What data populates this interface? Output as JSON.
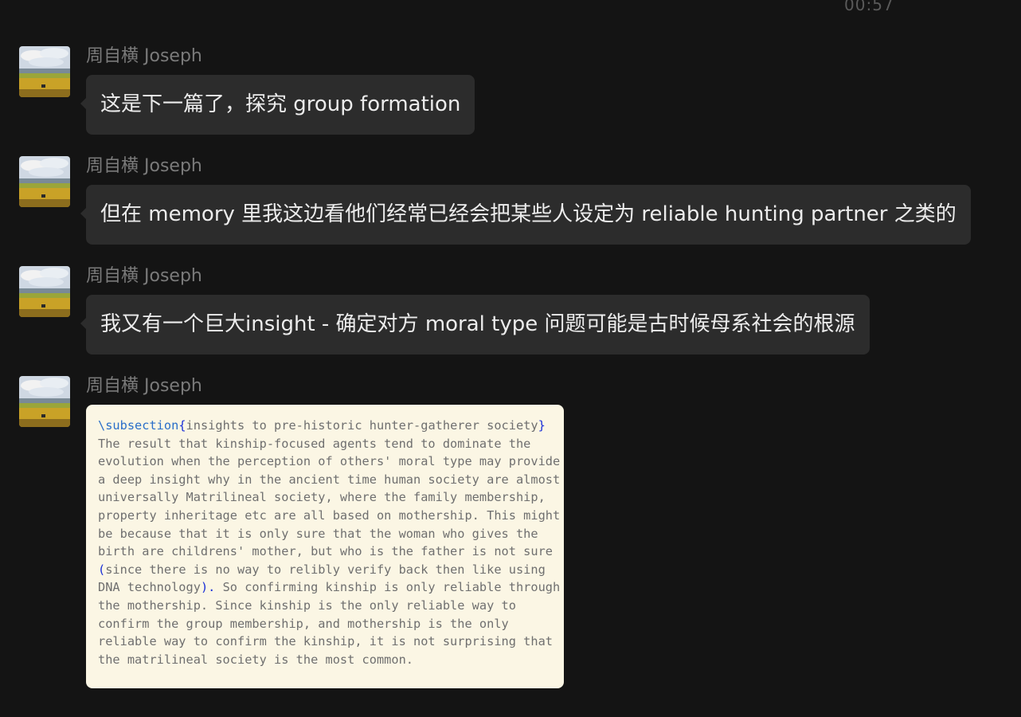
{
  "timestamp": "00:57",
  "messages": [
    {
      "sender": "周自横 Joseph",
      "text": "这是下一篇了，探究 group formation"
    },
    {
      "sender": "周自横 Joseph",
      "text": "但在 memory 里我这边看他们经常已经会把某些人设定为 reliable hunting partner 之类的"
    },
    {
      "sender": "周自横 Joseph",
      "text": "我又有一个巨大insight - 确定对方 moral type 问题可能是古时候母系社会的根源"
    },
    {
      "sender": "周自横 Joseph",
      "code": {
        "command": "\\subsection",
        "open_brace": "{",
        "heading": "insights to pre-historic hunter-gatherer society",
        "close_brace": "}",
        "line1": "The result that kinship-focused agents tend to dominate the",
        "line2": "evolution when the perception of others' moral type may provide",
        "line3": "a deep insight why in the ancient time human society are almost",
        "line4": "universally Matrilineal society, where the family membership,",
        "line5": "property inheritage etc are all based on mothership. This might",
        "line6": "be because that it is only sure that the woman who gives the",
        "line7": "birth are childrens' mother, but who is the father is not sure",
        "open_paren": "(",
        "line8": "since there is no way to relibly verify back then like using",
        "line9a": "DNA technology",
        "close_paren_dot": ").",
        "line9b": " So confirming kinship is only reliable through",
        "line10": "the mothership. Since kinship is the only reliable way to",
        "line11": "confirm the group membership, and mothership is the only",
        "line12": "reliable way to confirm the kinship, it is not surprising that",
        "line13": "the matrilineal society is the most common."
      }
    }
  ]
}
